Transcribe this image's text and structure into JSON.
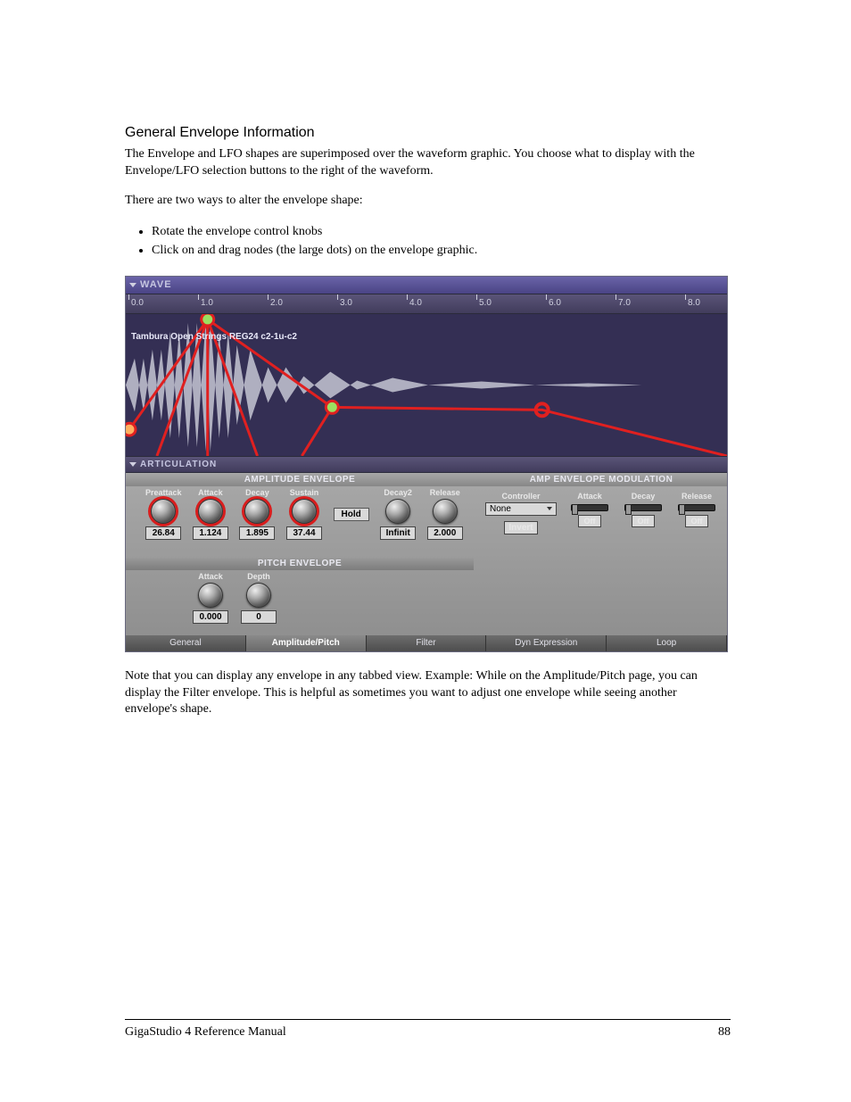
{
  "heading": "General Envelope Information",
  "para1": "The Envelope and LFO shapes are superimposed over the waveform graphic. You choose what to display with the Envelope/LFO selection buttons to the right of the waveform.",
  "para2": "There are two ways to alter the envelope shape:",
  "bullets": [
    "Rotate the envelope control knobs",
    "Click on and drag nodes (the large dots) on the envelope graphic."
  ],
  "para3": "Note that you can display any envelope in any tabbed view. Example: While on the Amplitude/Pitch page, you can display the Filter envelope. This is helpful as sometimes you want to adjust one envelope while seeing another envelope's shape.",
  "footer_left": "GigaStudio 4 Reference Manual",
  "footer_right": "88",
  "fig": {
    "wave_header": "WAVE",
    "ruler": [
      "0.0",
      "1.0",
      "2.0",
      "3.0",
      "4.0",
      "5.0",
      "6.0",
      "7.0",
      "8.0"
    ],
    "wave_name": "Tambura Open Strings REG24 c2-1u-c2",
    "articulation_header": "ARTICULATION",
    "amp_env_title": "AMPLITUDE ENVELOPE",
    "amp_knobs": [
      {
        "label": "Preattack",
        "value": "26.84"
      },
      {
        "label": "Attack",
        "value": "1.124"
      },
      {
        "label": "Decay",
        "value": "1.895"
      },
      {
        "label": "Sustain",
        "value": "37.44"
      },
      {
        "label": "Hold"
      },
      {
        "label": "Decay2",
        "value": "Infinit"
      },
      {
        "label": "Release",
        "value": "2.000"
      }
    ],
    "pitch_env_title": "PITCH ENVELOPE",
    "pitch_knobs": [
      {
        "label": "Attack",
        "value": "0.000"
      },
      {
        "label": "Depth",
        "value": "0"
      }
    ],
    "mod_title": "AMP ENVELOPE MODULATION",
    "mod": {
      "controller_label": "Controller",
      "controller_value": "None",
      "invert_label": "Invert",
      "cols": [
        {
          "label": "Attack",
          "off": "Off"
        },
        {
          "label": "Decay",
          "off": "Off"
        },
        {
          "label": "Release",
          "off": "Off"
        }
      ]
    },
    "tabs": [
      "General",
      "Amplitude/Pitch",
      "Filter",
      "Dyn Expression",
      "Loop"
    ],
    "active_tab": 1
  }
}
